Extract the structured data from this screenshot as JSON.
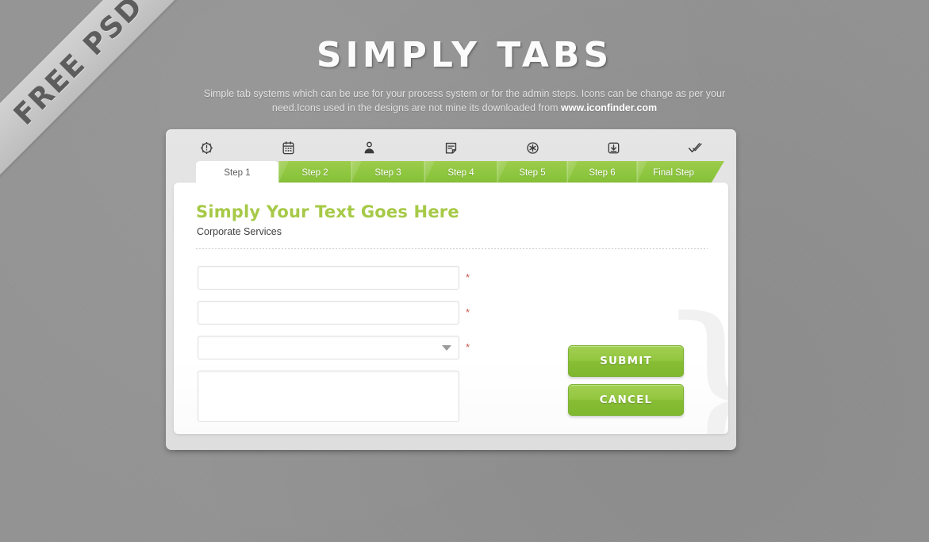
{
  "ribbon": {
    "text": "FREE PSD"
  },
  "header": {
    "title": "SIMPLY TABS",
    "subtitle_part1": "Simple tab systems which can be use for your process system or for the admin steps. Icons can be change as per your need.Icons used in the designs are not mine its downloaded from ",
    "link_text": "www.iconfinder.com"
  },
  "icons": [
    {
      "name": "gear-icon"
    },
    {
      "name": "calendar-icon"
    },
    {
      "name": "user-icon"
    },
    {
      "name": "edit-note-icon"
    },
    {
      "name": "asterisk-circle-icon"
    },
    {
      "name": "download-icon"
    },
    {
      "name": "check-icon"
    }
  ],
  "tabs": [
    {
      "label": "Step 1",
      "active": true
    },
    {
      "label": "Step 2",
      "active": false
    },
    {
      "label": "Step 3",
      "active": false
    },
    {
      "label": "Step 4",
      "active": false
    },
    {
      "label": "Step 5",
      "active": false
    },
    {
      "label": "Step 6",
      "active": false
    },
    {
      "label": "Final Step",
      "active": false
    }
  ],
  "panel": {
    "heading": "Simply Your Text Goes Here",
    "subheading": "Corporate Services",
    "required_marker": "*",
    "brace_glyph": "}",
    "fields": [
      {
        "name": "field-one",
        "type": "text",
        "value": "",
        "placeholder": ""
      },
      {
        "name": "field-two",
        "type": "text",
        "value": "",
        "placeholder": ""
      },
      {
        "name": "field-select",
        "type": "select",
        "value": "",
        "placeholder": ""
      },
      {
        "name": "field-message",
        "type": "textarea",
        "value": "",
        "placeholder": ""
      }
    ]
  },
  "buttons": {
    "submit_label": "SUBMIT",
    "cancel_label": "CANCEL"
  },
  "colors": {
    "background": "#939393",
    "accent_green": "#8dc63f",
    "heading_green": "#a6c947",
    "required_red": "#c45a52",
    "card_gray": "#e2e2e2"
  }
}
